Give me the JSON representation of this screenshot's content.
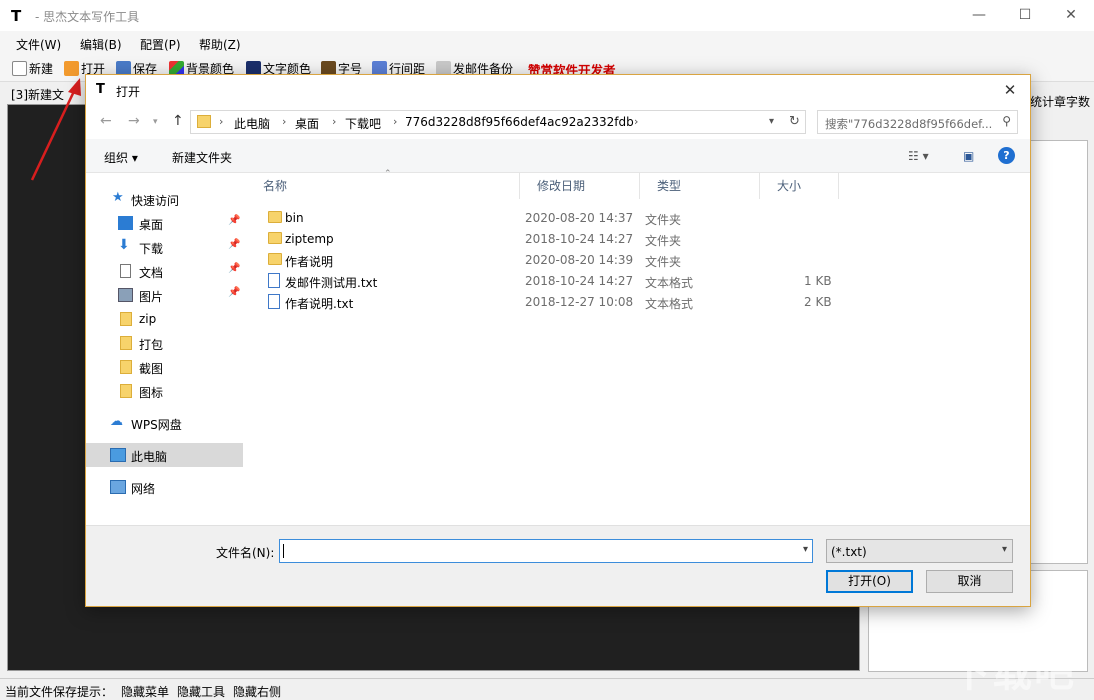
{
  "app": {
    "title": "- 思杰文本写作工具",
    "icon": "T",
    "controls": {
      "minimize": "—",
      "maximize": "☐",
      "close": "✕"
    }
  },
  "menubar": {
    "items": [
      "文件(W)",
      "编辑(B)",
      "配置(P)",
      "帮助(Z)"
    ]
  },
  "toolbar": {
    "new": "新建",
    "open": "打开",
    "save": "保存",
    "bg_color": "背景颜色",
    "text_color": "文字颜色",
    "font_size": "字号",
    "line_spacing": "行间距",
    "email_backup": "发邮件备份",
    "promo": "赞赏软件开发者"
  },
  "tab": {
    "label": "[3]新建文"
  },
  "right_label": "统计章字数",
  "statusbar": {
    "hint": "当前文件保存提示：",
    "hide_menu": "隐藏菜单",
    "hide_tools": "隐藏工具",
    "hide_right": "隐藏右侧"
  },
  "dialog": {
    "title": "打开",
    "icon": "T",
    "close": "✕",
    "breadcrumb": [
      "此电脑",
      "桌面",
      "下载吧",
      "776d3228d8f95f66def4ac92a2332fdb"
    ],
    "search_placeholder": "搜索\"776d3228d8f95f66def...",
    "organize": "组织 ▾",
    "new_folder": "新建文件夹",
    "help": "?",
    "nav": {
      "quick_access": "快速访问",
      "items": [
        {
          "label": "桌面",
          "icon": "desktop-icon",
          "pinned": true
        },
        {
          "label": "下载",
          "icon": "download-icon",
          "pinned": true
        },
        {
          "label": "文档",
          "icon": "document-icon",
          "pinned": true
        },
        {
          "label": "图片",
          "icon": "picture-icon",
          "pinned": true
        },
        {
          "label": "zip",
          "icon": "folder-icon",
          "pinned": false
        },
        {
          "label": "打包",
          "icon": "folder-icon",
          "pinned": false
        },
        {
          "label": "截图",
          "icon": "folder-icon",
          "pinned": false
        },
        {
          "label": "图标",
          "icon": "folder-icon",
          "pinned": false
        }
      ],
      "wps": "WPS网盘",
      "this_pc": "此电脑",
      "network": "网络"
    },
    "columns": {
      "name": "名称",
      "date": "修改日期",
      "type": "类型",
      "size": "大小"
    },
    "files": [
      {
        "name": "bin",
        "date": "2020-08-20 14:37",
        "type": "文件夹",
        "size": "",
        "kind": "folder"
      },
      {
        "name": "ziptemp",
        "date": "2018-10-24 14:27",
        "type": "文件夹",
        "size": "",
        "kind": "folder"
      },
      {
        "name": "作者说明",
        "date": "2020-08-20 14:39",
        "type": "文件夹",
        "size": "",
        "kind": "folder"
      },
      {
        "name": "发邮件测试用.txt",
        "date": "2018-10-24 14:27",
        "type": "文本格式",
        "size": "1 KB",
        "kind": "txt"
      },
      {
        "name": "作者说明.txt",
        "date": "2018-12-27 10:08",
        "type": "文本格式",
        "size": "2 KB",
        "kind": "txt"
      }
    ],
    "filename_label": "文件名(N):",
    "filename_value": "",
    "filetype": "(*.txt)",
    "open_button": "打开(O)",
    "cancel_button": "取消"
  },
  "watermark": "下载吧"
}
